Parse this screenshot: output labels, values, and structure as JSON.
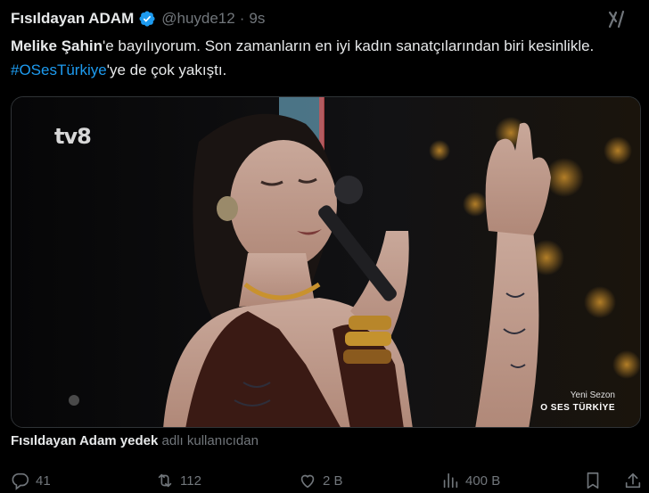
{
  "tweet": {
    "author_name": "Fısıldayan ADAM",
    "handle": "@huyde12",
    "separator": "·",
    "time": "9s",
    "text_bold": "Melike Şahin",
    "text_part1": "'e bayılıyorum. Son zamanların en iyi kadın sanatçılarından biri kesinlikle. ",
    "hashtag": "#OSesTürkiye",
    "text_part2": "'ye de çok yakıştı."
  },
  "media": {
    "channel_logo": "tv8",
    "overlay_season": "Yeni Sezon",
    "overlay_show": "O SES TÜRKİYE"
  },
  "attribution": {
    "name": "Fısıldayan Adam yedek",
    "rest": "adlı kullanıcıdan"
  },
  "actions": {
    "replies": "41",
    "retweets": "112",
    "likes": "2 B",
    "views": "400 B"
  },
  "colors": {
    "accent": "#1d9bf0",
    "muted": "#71767b",
    "text": "#e7e9ea",
    "background": "#000000"
  },
  "icons": [
    "verified-badge-icon",
    "grok-icon",
    "reply-icon",
    "retweet-icon",
    "like-icon",
    "views-icon",
    "bookmark-icon",
    "share-icon"
  ]
}
